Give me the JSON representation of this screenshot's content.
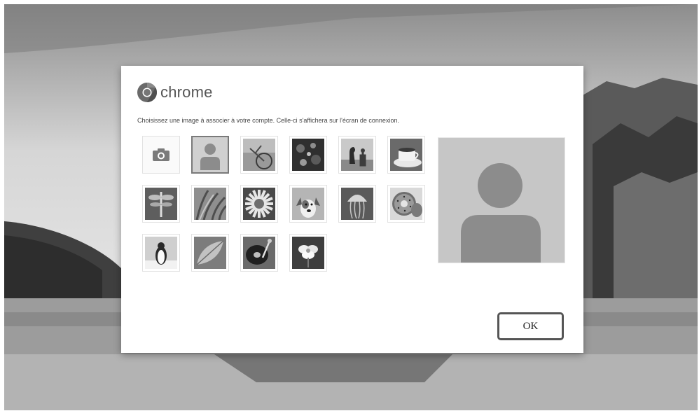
{
  "brand": {
    "name": "chrome",
    "logo_icon": "chrome-logo-icon"
  },
  "instructions": "Choisissez une image à associer à votre compte. Celle-ci s'affichera sur l'écran de connexion.",
  "tiles": [
    {
      "name": "camera-tile",
      "icon": "camera-icon",
      "selected": false
    },
    {
      "name": "default-avatar-tile",
      "icon": "person-icon",
      "selected": true
    },
    {
      "name": "bicycle-image-tile",
      "icon": "bicycle-icon",
      "selected": false
    },
    {
      "name": "bokeh-image-tile",
      "icon": "bokeh-icon",
      "selected": false
    },
    {
      "name": "chess-image-tile",
      "icon": "chess-icon",
      "selected": false
    },
    {
      "name": "coffee-image-tile",
      "icon": "coffee-cup-icon",
      "selected": false
    },
    {
      "name": "dragonfly-image-tile",
      "icon": "dragonfly-icon",
      "selected": false
    },
    {
      "name": "grass-image-tile",
      "icon": "grass-icon",
      "selected": false
    },
    {
      "name": "daisy-image-tile",
      "icon": "daisy-icon",
      "selected": false
    },
    {
      "name": "dog-image-tile",
      "icon": "dog-icon",
      "selected": false
    },
    {
      "name": "jellyfish-image-tile",
      "icon": "jellyfish-icon",
      "selected": false
    },
    {
      "name": "kiwi-image-tile",
      "icon": "kiwi-icon",
      "selected": false
    },
    {
      "name": "penguin-image-tile",
      "icon": "penguin-icon",
      "selected": false
    },
    {
      "name": "leaf-image-tile",
      "icon": "leaf-icon",
      "selected": false
    },
    {
      "name": "turntable-image-tile",
      "icon": "turntable-icon",
      "selected": false
    },
    {
      "name": "flower-image-tile",
      "icon": "flower-icon",
      "selected": false
    }
  ],
  "buttons": {
    "ok": "OK"
  }
}
